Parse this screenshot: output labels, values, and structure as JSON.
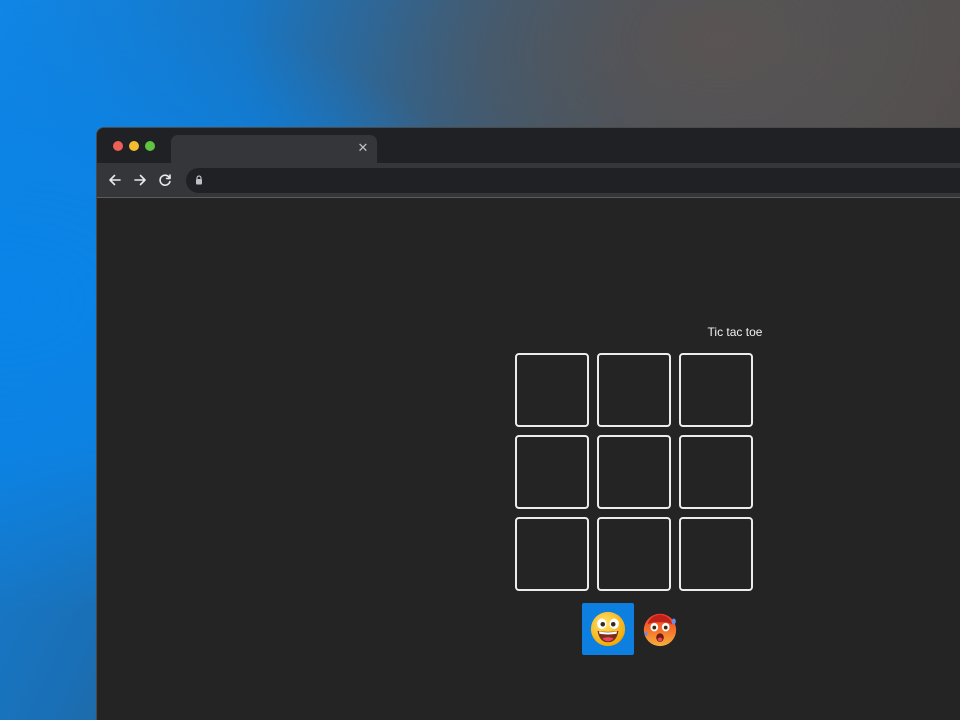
{
  "window": {
    "controls": [
      "close",
      "minimize",
      "maximize"
    ],
    "tab": {
      "title": "",
      "close_icon": "close-icon"
    }
  },
  "toolbar": {
    "back_icon": "arrow-left-icon",
    "forward_icon": "arrow-right-icon",
    "reload_icon": "reload-icon",
    "address": {
      "value": "",
      "lock_icon": "lock-icon"
    }
  },
  "game": {
    "title": "Tic tac toe",
    "board": [
      "",
      "",
      "",
      "",
      "",
      "",
      "",
      "",
      ""
    ],
    "players": [
      {
        "icon": "grinning-face-emoji-icon",
        "active": true
      },
      {
        "icon": "hot-face-emoji-icon",
        "active": false
      }
    ]
  },
  "colors": {
    "active_player_bg": "#0c7fe0",
    "page_bg": "#242424",
    "cell_border": "#ececec"
  }
}
